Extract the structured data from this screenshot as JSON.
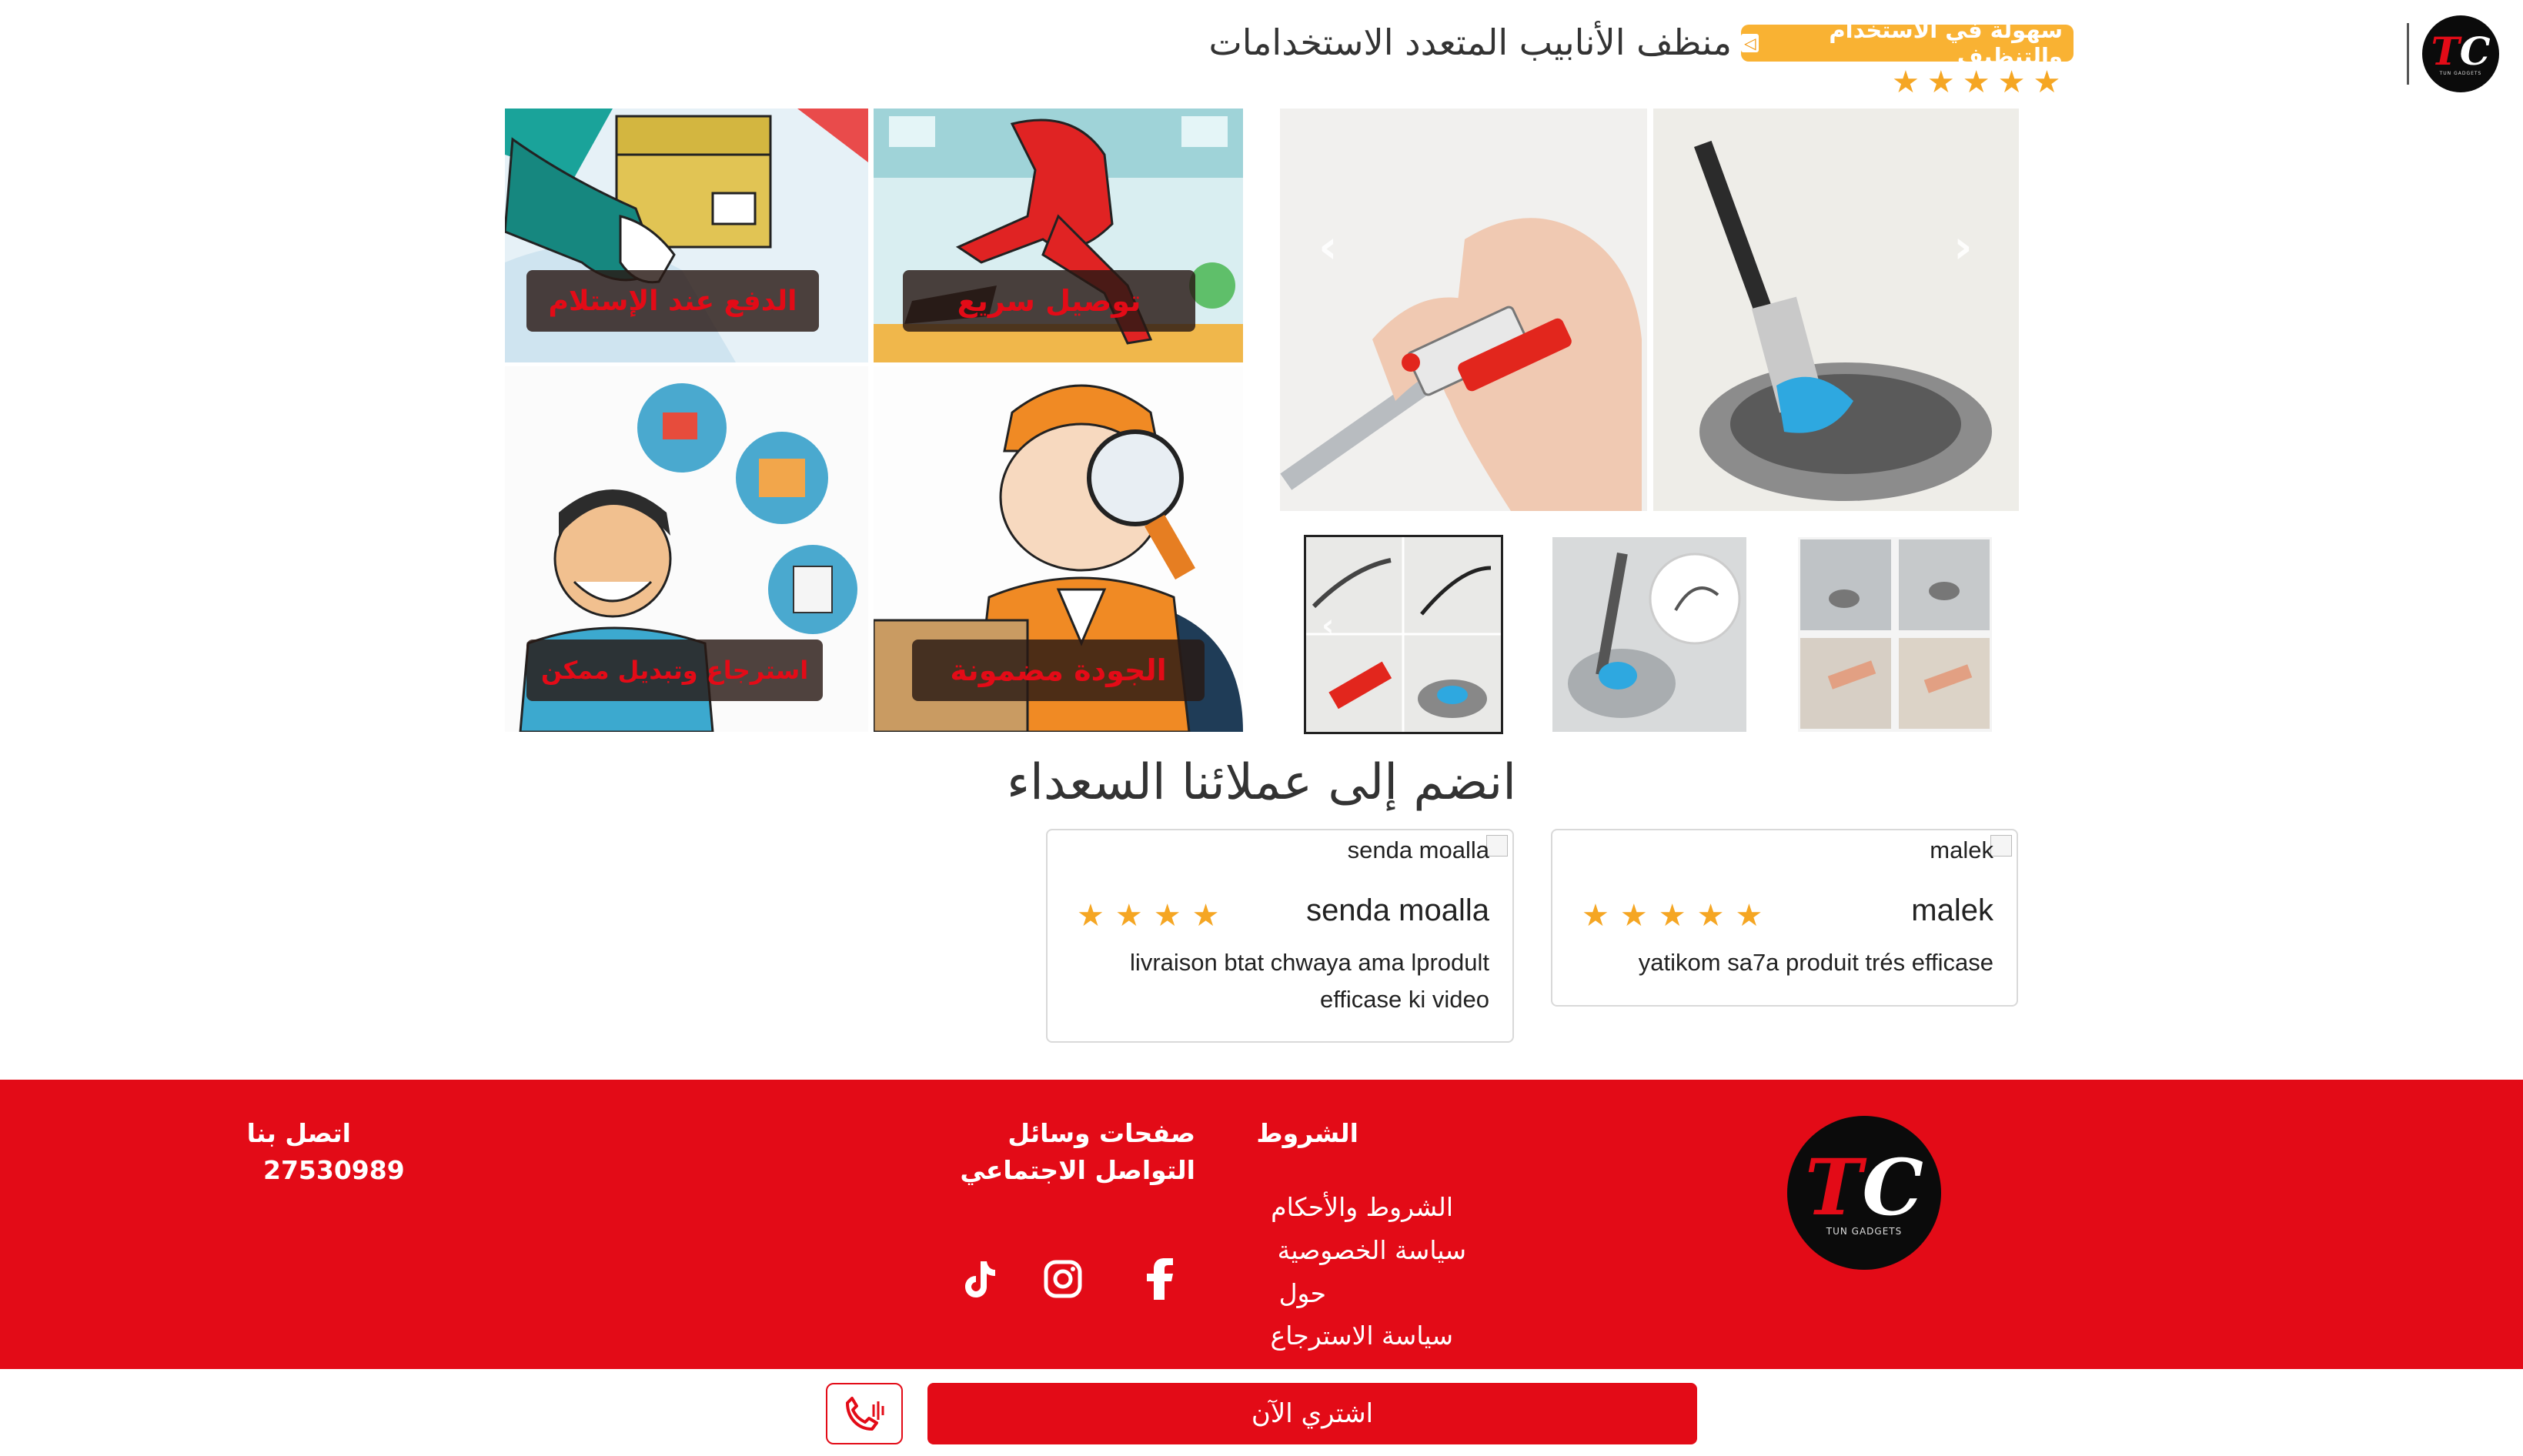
{
  "header": {
    "logo": {
      "monogram_t": "T",
      "monogram_c": "C",
      "tagline": "TUN GADGETS"
    },
    "product_title": "منظف الأنابيب المتعدد الاستخدامات",
    "badge_label": "سهولة في الاستخدام والتنظيف",
    "rating_stars": 5
  },
  "promo": {
    "tiles": [
      {
        "label": "الدفع عند الإستلام"
      },
      {
        "label": "توصيل سريع"
      },
      {
        "label": "استرجاع وتبديل ممكن"
      },
      {
        "label": "الجودة مضمونة"
      }
    ]
  },
  "gallery": {
    "thumbnails": [
      {
        "name": "thumb-1",
        "selected": true
      },
      {
        "name": "thumb-2",
        "selected": false
      },
      {
        "name": "thumb-3",
        "selected": false
      }
    ]
  },
  "reviews": {
    "title": "انضم إلى عملائنا السعداء",
    "items": [
      {
        "image_alt": "malek",
        "name": "malek",
        "stars": 5,
        "text_line1": "yatikom sa7a produit trés efficase",
        "text_line2": ""
      },
      {
        "image_alt": "senda moalla",
        "name": "senda moalla",
        "stars": 4,
        "text_line1": "livraison btat chwaya ama lprodult",
        "text_line2": "efficase ki video"
      }
    ]
  },
  "footer": {
    "terms_heading": "الشروط",
    "terms_links": [
      "الشروط والأحكام",
      "سياسة الخصوصية",
      "حول",
      "سياسة الاسترجاع"
    ],
    "social_heading": "صفحات وسائل التواصل الاجتماعي",
    "social_icons": [
      "facebook-icon",
      "instagram-icon",
      "tiktok-icon"
    ],
    "contact_heading": "اتصل بنا",
    "contact_phone": "27530989"
  },
  "cta": {
    "buy_label": "اشتري الآن"
  },
  "colors": {
    "brand_red": "#e30b17",
    "star_gold": "#f5a623",
    "badge_orange": "#f9b233"
  }
}
